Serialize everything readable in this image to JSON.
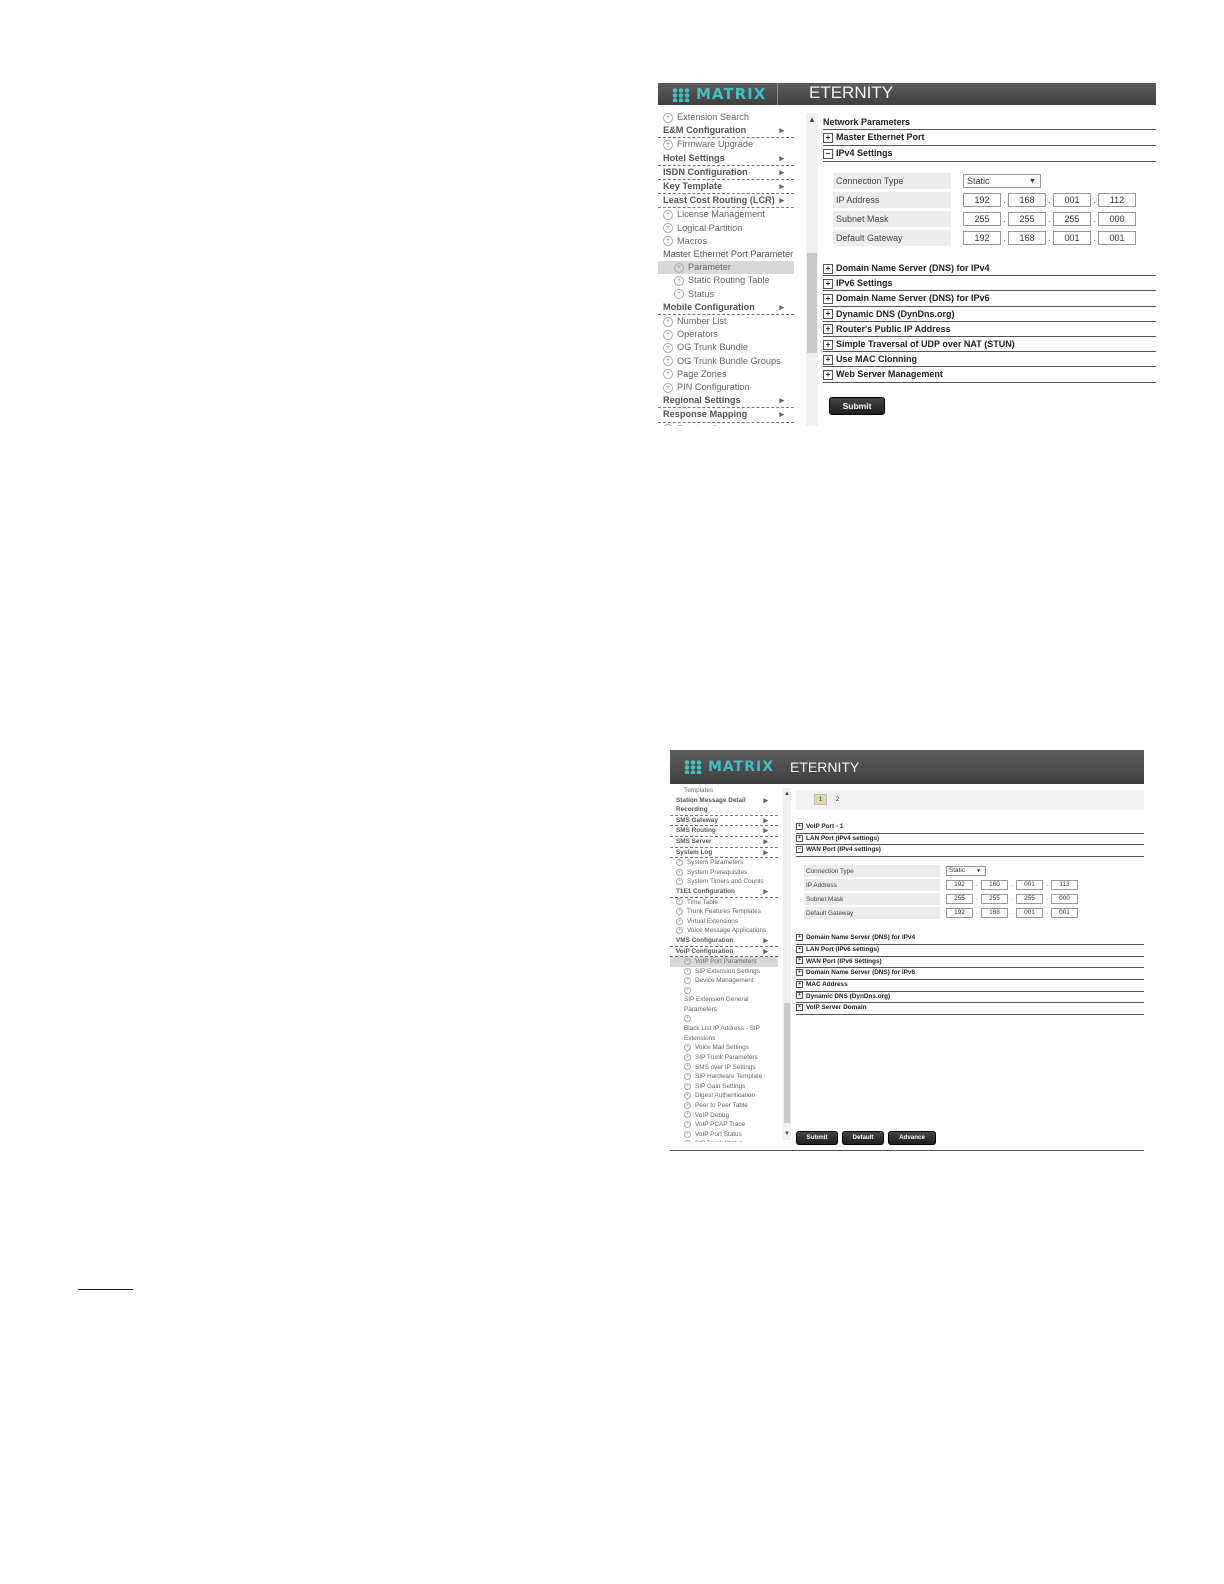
{
  "screen1": {
    "header": {
      "logo_text": "MATRIX",
      "product": "ETERNITY"
    },
    "sidebar": [
      {
        "label": "Extension Search",
        "kind": "sub"
      },
      {
        "label": "E&M Configuration",
        "kind": "group"
      },
      {
        "label": "Firmware Upgrade",
        "kind": "sub"
      },
      {
        "label": "Hotel Settings",
        "kind": "group"
      },
      {
        "label": "ISDN Configuration",
        "kind": "group"
      },
      {
        "label": "Key Template",
        "kind": "group"
      },
      {
        "label": "Least Cost Routing (LCR)",
        "kind": "group"
      },
      {
        "label": "License Management",
        "kind": "sub"
      },
      {
        "label": "Logical Partition",
        "kind": "sub"
      },
      {
        "label": "Macros",
        "kind": "sub"
      },
      {
        "label": "Master Ethernet Port Parameter",
        "kind": "plain"
      },
      {
        "label": "Parameter",
        "kind": "sub2",
        "selected": true
      },
      {
        "label": "Static Routing Table",
        "kind": "sub2"
      },
      {
        "label": "Status",
        "kind": "sub2"
      },
      {
        "label": "Mobile Configuration",
        "kind": "group"
      },
      {
        "label": "Number List",
        "kind": "sub"
      },
      {
        "label": "Operators",
        "kind": "sub"
      },
      {
        "label": "OG Trunk Bundle",
        "kind": "sub"
      },
      {
        "label": "OG Trunk Bundle Groups",
        "kind": "sub"
      },
      {
        "label": "Page Zones",
        "kind": "sub"
      },
      {
        "label": "PIN Configuration",
        "kind": "sub"
      },
      {
        "label": "Regional Settings",
        "kind": "group"
      },
      {
        "label": "Response Mapping",
        "kind": "group"
      },
      {
        "label": "Routing Group",
        "kind": "sub"
      }
    ],
    "page_title": "Network Parameters",
    "sections_before": [
      {
        "label": "Master Ethernet Port",
        "expanded": false
      },
      {
        "label": "IPv4 Settings",
        "expanded": true
      }
    ],
    "form": {
      "connection_type_label": "Connection Type",
      "connection_type_value": "Static",
      "rows": [
        {
          "label": "IP Address",
          "octets": [
            "192",
            "168",
            "001",
            "112"
          ]
        },
        {
          "label": "Subnet Mask",
          "octets": [
            "255",
            "255",
            "255",
            "000"
          ]
        },
        {
          "label": "Default Gateway",
          "octets": [
            "192",
            "168",
            "001",
            "001"
          ]
        }
      ]
    },
    "sections_after": [
      {
        "label": "Domain Name Server (DNS) for IPv4"
      },
      {
        "label": "IPv6 Settings"
      },
      {
        "label": "Domain Name Server (DNS) for IPv6"
      },
      {
        "label": "Dynamic DNS (DynDns.org)"
      },
      {
        "label": "Router's Public IP Address"
      },
      {
        "label": "Simple Traversal of UDP over NAT (STUN)"
      },
      {
        "label": "Use MAC Clonning"
      },
      {
        "label": "Web Server Management"
      }
    ],
    "buttons": [
      {
        "label": "Submit"
      }
    ]
  },
  "screen2": {
    "header": {
      "logo_text": "MATRIX",
      "product": "ETERNITY"
    },
    "sidebar": [
      {
        "label": "Templates",
        "kind": "sub2"
      },
      {
        "label": "Station Message Detail Recording",
        "kind": "group"
      },
      {
        "label": "SMS Gateway",
        "kind": "group"
      },
      {
        "label": "SMS Routing",
        "kind": "group"
      },
      {
        "label": "SMS Server",
        "kind": "group"
      },
      {
        "label": "System Log",
        "kind": "group"
      },
      {
        "label": "System Parameters",
        "kind": "sub"
      },
      {
        "label": "System Prerequisites",
        "kind": "sub"
      },
      {
        "label": "System Timers and Counts",
        "kind": "sub"
      },
      {
        "label": "T1E1 Configuration",
        "kind": "group"
      },
      {
        "label": "Time Table",
        "kind": "sub"
      },
      {
        "label": "Trunk Features Templates",
        "kind": "sub"
      },
      {
        "label": "Virtual Extensions",
        "kind": "sub"
      },
      {
        "label": "Voice Message Applications",
        "kind": "sub"
      },
      {
        "label": "VMS Configuration",
        "kind": "group"
      },
      {
        "label": "VoIP Configuration",
        "kind": "group"
      },
      {
        "label": "VoIP Port Parameters",
        "kind": "sub2",
        "selected": true
      },
      {
        "label": "SIP Extension Settings",
        "kind": "sub2"
      },
      {
        "label": "Device Management",
        "kind": "sub2"
      },
      {
        "label": "SIP Extension General Parameters",
        "kind": "sub2"
      },
      {
        "label": "Black List IP Address - SIP Extensions",
        "kind": "sub2"
      },
      {
        "label": "Voice Mail Settings",
        "kind": "sub2"
      },
      {
        "label": "SIP Trunk Parameters",
        "kind": "sub2"
      },
      {
        "label": "SMS over IP Settings",
        "kind": "sub2"
      },
      {
        "label": "SIP Hardware Template",
        "kind": "sub2"
      },
      {
        "label": "SIP Gain Settings",
        "kind": "sub2"
      },
      {
        "label": "Digest Authentication",
        "kind": "sub2"
      },
      {
        "label": "Peer to Peer Table",
        "kind": "sub2"
      },
      {
        "label": "VoIP Debug",
        "kind": "sub2"
      },
      {
        "label": "VoIP PCAP Trace",
        "kind": "sub2"
      },
      {
        "label": "VoIP Port Status",
        "kind": "sub2"
      },
      {
        "label": "SIP Trunk Status",
        "kind": "sub2"
      },
      {
        "label": "SIP Extension Status",
        "kind": "sub2"
      }
    ],
    "tabs": [
      {
        "label": "1",
        "active": true
      },
      {
        "label": "2",
        "active": false
      }
    ],
    "sections_before": [
      {
        "label": "VoIP Port - 1",
        "expanded": false
      },
      {
        "label": "LAN Port (IPv4 settings)",
        "expanded": false
      },
      {
        "label": "WAN Port (IPv4 settings)",
        "expanded": true
      }
    ],
    "form": {
      "connection_type_label": "Connection Type",
      "connection_type_value": "Static",
      "rows": [
        {
          "label": "IP Address",
          "octets": [
            "192",
            "160",
            "001",
            "113"
          ]
        },
        {
          "label": "Subnet Mask",
          "octets": [
            "255",
            "255",
            "255",
            "000"
          ]
        },
        {
          "label": "Default Gateway",
          "octets": [
            "192",
            "168",
            "001",
            "001"
          ]
        }
      ]
    },
    "sections_after": [
      {
        "label": "Domain Name Server (DNS) for IPv4"
      },
      {
        "label": "LAN Port (IPv6 settings)"
      },
      {
        "label": "WAN Port (IPv6 Settings)"
      },
      {
        "label": "Domain Name Server (DNS) for IPv6"
      },
      {
        "label": "MAC Address"
      },
      {
        "label": "Dynamic DNS (DynDns.org)"
      },
      {
        "label": "VoIP Server Domain"
      }
    ],
    "buttons": [
      {
        "label": "Submit"
      },
      {
        "label": "Default"
      },
      {
        "label": "Advance"
      }
    ]
  }
}
